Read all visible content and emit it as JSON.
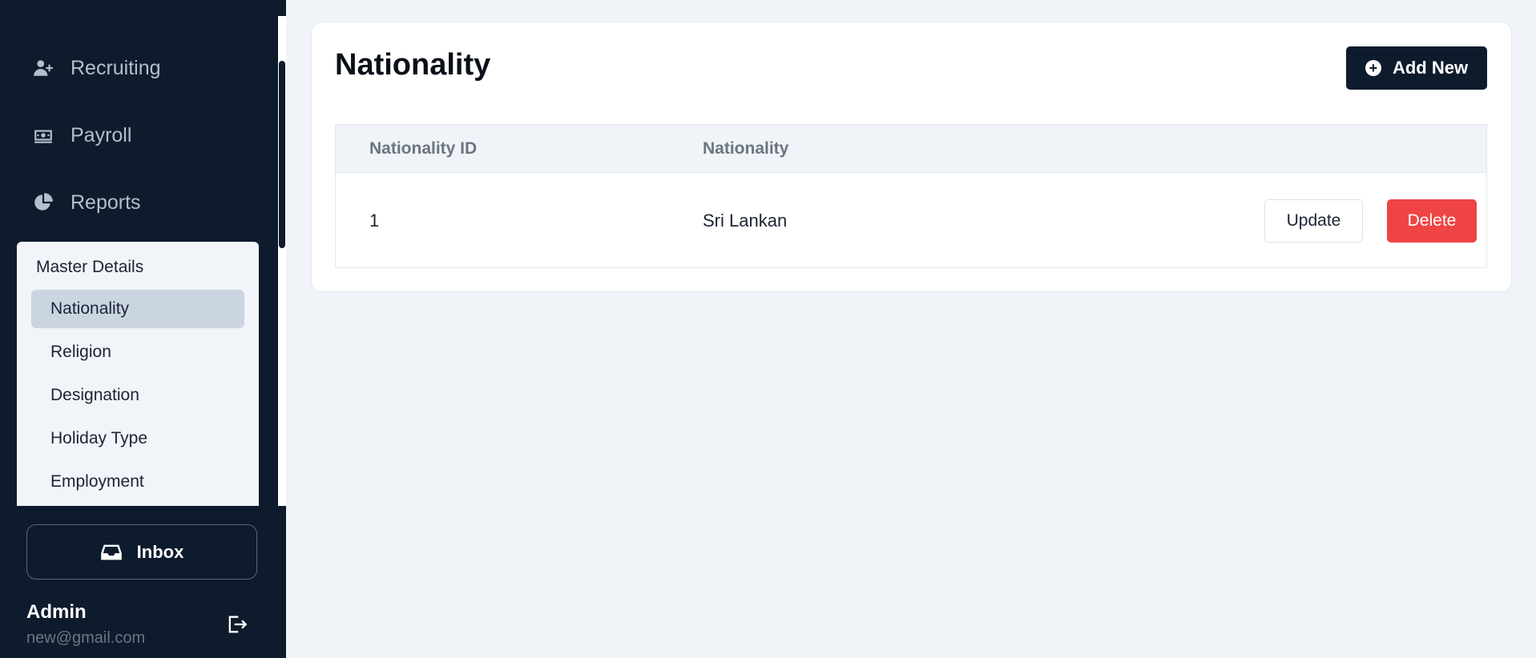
{
  "sidebar": {
    "nav": [
      {
        "label": "Recruiting",
        "icon": "user-plus-icon"
      },
      {
        "label": "Payroll",
        "icon": "money-icon"
      },
      {
        "label": "Reports",
        "icon": "pie-chart-icon"
      }
    ],
    "submenu": {
      "title": "Master Details",
      "items": [
        {
          "label": "Nationality",
          "active": true
        },
        {
          "label": "Religion"
        },
        {
          "label": "Designation"
        },
        {
          "label": "Holiday Type"
        },
        {
          "label": "Employment"
        }
      ]
    },
    "inbox_label": "Inbox",
    "user": {
      "name": "Admin",
      "email": "new@gmail.com"
    }
  },
  "main": {
    "title": "Nationality",
    "add_label": "Add New",
    "table": {
      "headers": [
        "Nationality ID",
        "Nationality"
      ],
      "rows": [
        {
          "id": "1",
          "nationality": "Sri Lankan"
        }
      ],
      "update_label": "Update",
      "delete_label": "Delete"
    }
  },
  "colors": {
    "sidebar_bg": "#0e1b2c",
    "primary_button": "#0e1b2c",
    "danger": "#ef4444",
    "active_item": "#cbd5e1"
  }
}
